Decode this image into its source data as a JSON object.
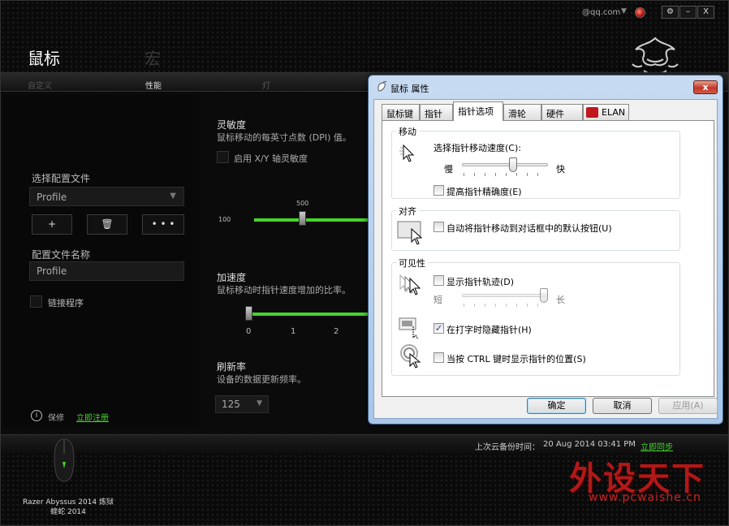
{
  "app": {
    "account": "@qq.com",
    "window_buttons": [
      "⚙",
      "–",
      "X"
    ],
    "title_main": "鼠标",
    "title_secondary": "宏",
    "tabs": [
      {
        "label": "自定义",
        "active": false
      },
      {
        "label": "性能",
        "active": true
      },
      {
        "label": "灯",
        "active": false
      }
    ]
  },
  "left": {
    "select_profile_label": "选择配置文件",
    "profile_dropdown_value": "Profile",
    "buttons": [
      "+",
      "🗑",
      "• • •"
    ],
    "profile_name_label": "配置文件名称",
    "profile_name_value": "Profile",
    "link_program_label": "链接程序",
    "warranty_label": "保修",
    "register_link": "立即注册"
  },
  "performance": {
    "sensitivity": {
      "title": "灵敏度",
      "desc": "鼠标移动的每英寸点数 (DPI) 值。",
      "xy_checkbox_label": "启用 X/Y 轴灵敏度",
      "min_label": "100",
      "value_label": "500"
    },
    "acceleration": {
      "title": "加速度",
      "desc": "鼠标移动时指针速度增加的比率。",
      "ticks": [
        "0",
        "1",
        "2"
      ]
    },
    "polling": {
      "title": "刷新率",
      "desc": "设备的数据更新频率。",
      "value": "125"
    }
  },
  "footer": {
    "device_name_line1": "Razer Abyssus 2014 炼狱",
    "device_name_line2": "蝰蛇 2014",
    "backup_label": "上次云备份时间：",
    "backup_time": "20 Aug 2014 03:41 PM",
    "sync_link": "立即同步",
    "watermark_cn": "外设天下",
    "watermark_url": "www.pcwaishe.cn"
  },
  "dialog": {
    "title": "鼠标 属性",
    "close": "x",
    "tabs": [
      {
        "label": "鼠标键",
        "active": false
      },
      {
        "label": "指针",
        "active": false
      },
      {
        "label": "指针选项",
        "active": true
      },
      {
        "label": "滑轮",
        "active": false
      },
      {
        "label": "硬件",
        "active": false
      },
      {
        "label": "ELAN",
        "active": false
      }
    ],
    "motion": {
      "group": "移动",
      "speed_label": "选择指针移动速度(C):",
      "slow": "慢",
      "fast": "快",
      "speed_level": 0.6,
      "precision_label": "提高指针精确度(E)",
      "precision_checked": false
    },
    "snap": {
      "group": "对齐",
      "label": "自动将指针移动到对话框中的默认按钮(U)",
      "checked": false
    },
    "visibility": {
      "group": "可见性",
      "trails_label": "显示指针轨迹(D)",
      "trails_checked": false,
      "short": "短",
      "long": "长",
      "trail_level": 1.0,
      "hide_label": "在打字时隐藏指针(H)",
      "hide_checked": true,
      "hide_mark": "✓",
      "ctrl_label": "当按 CTRL 键时显示指针的位置(S)",
      "ctrl_checked": false
    },
    "buttons": {
      "ok": "确定",
      "cancel": "取消",
      "apply": "应用(A)"
    }
  }
}
